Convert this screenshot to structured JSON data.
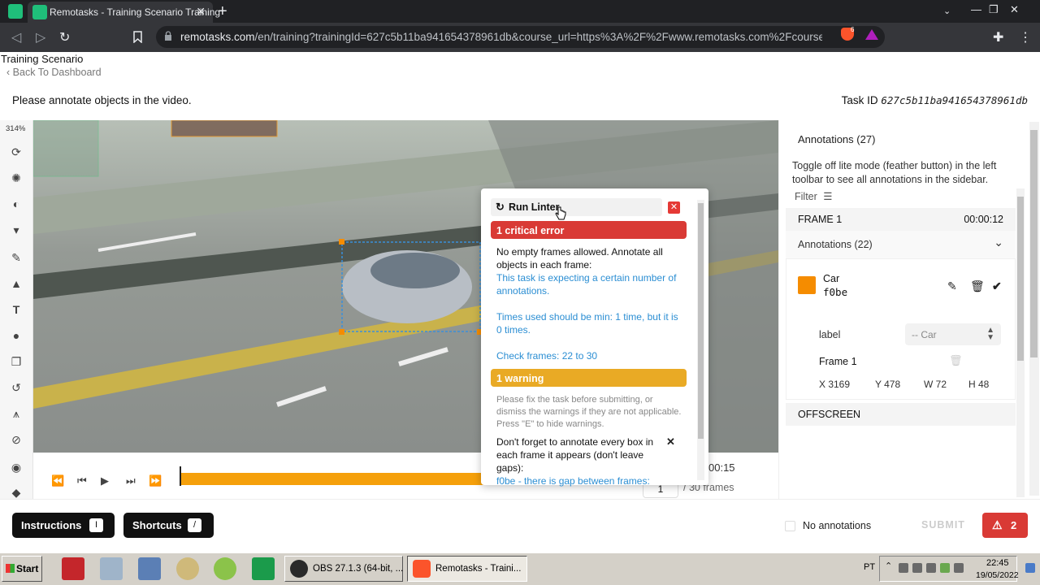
{
  "browser": {
    "tab_title": "Remotasks - Training Scenario Training",
    "url_host": "remotasks.com",
    "url_rest": "/en/training?trainingId=627c5b11ba941654378961db&course_url=https%3A%2F%2Fwww.remotasks.com%2Fcourse...",
    "brave_badge": "6"
  },
  "header": {
    "app_title": "Training Scenario",
    "back_label": "Back To Dashboard",
    "instruction": "Please annotate objects in the video.",
    "task_id_label": "Task ID",
    "task_id_value": "627c5b11ba941654378961db"
  },
  "toolbar": {
    "zoom": "314%"
  },
  "timeline": {
    "time_end": "00:15",
    "frame_value": "1",
    "frame_total": "/ 30 frames"
  },
  "linter": {
    "run_label": "Run Linter",
    "critical_label": "1 critical error",
    "error_title": "No empty frames allowed. Annotate all objects in each frame:",
    "error_detail": "This task is expecting a certain number of annotations.",
    "times_used": "Times used should be min: 1 time, but it is 0 times.",
    "check_frames": "Check frames: 22 to 30",
    "warning_label": "1 warning",
    "warning_help": "Please fix the task before submitting, or dismiss the warnings if they are not applicable. Press \"E\" to hide warnings.",
    "warning_title": "Don't forget to annotate every box in each frame it appears (don't leave gaps):",
    "warning_detail": "f0be - there is gap between frames:"
  },
  "sidebar": {
    "annotations_title": "Annotations (27)",
    "toggle_note": "Toggle off lite mode (feather button) in the left toolbar to see all annotations in the sidebar.",
    "filter_label": "Filter",
    "frame_label": "FRAME 1",
    "frame_time": "00:00:12",
    "sub_title": "Annotations (22)",
    "item": {
      "name": "Car",
      "id": "f0be",
      "color": "#f58c00",
      "label_key": "label",
      "label_value": "-- Car",
      "frame_label": "Frame 1",
      "x": "X 3169",
      "y": "Y 478",
      "w": "W 72",
      "h": "H 48"
    },
    "offscreen_label": "OFFSCREEN"
  },
  "bottom": {
    "instructions_label": "Instructions",
    "instructions_key": "I",
    "shortcuts_label": "Shortcuts",
    "shortcuts_key": "/",
    "no_annotations_label": "No annotations",
    "submit_label": "SUBMIT",
    "error_count": "2"
  },
  "taskbar": {
    "start_label": "Start",
    "obs_label": "OBS 27.1.3 (64-bit, ...",
    "remotasks_label": "Remotasks - Traini...",
    "lang": "PT",
    "time": "22:45",
    "date": "19/05/2022"
  }
}
